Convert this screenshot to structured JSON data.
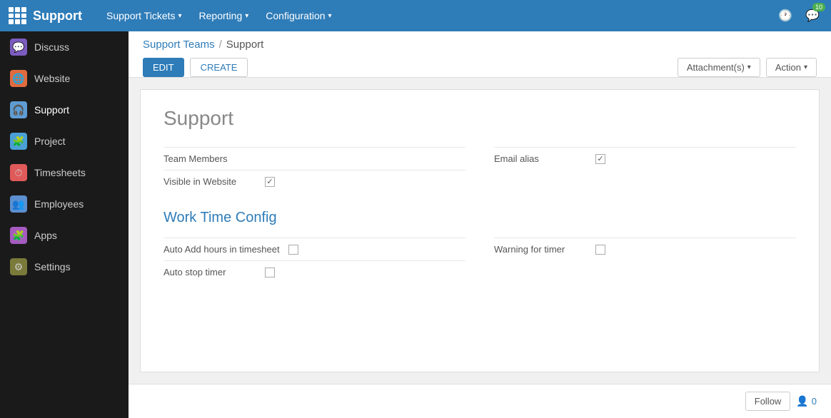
{
  "app": {
    "name": "Support",
    "grid_icon": "grid-icon"
  },
  "topnav": {
    "items": [
      {
        "label": "Support Tickets",
        "has_dropdown": true
      },
      {
        "label": "Reporting",
        "has_dropdown": true
      },
      {
        "label": "Configuration",
        "has_dropdown": true
      }
    ]
  },
  "topbar_right": {
    "clock_icon": "clock-icon",
    "messages_icon": "messages-icon",
    "messages_badge": "10"
  },
  "sidebar": {
    "items": [
      {
        "label": "Discuss",
        "icon_class": "icon-discuss",
        "icon": "💬"
      },
      {
        "label": "Website",
        "icon_class": "icon-website",
        "icon": "🌐"
      },
      {
        "label": "Support",
        "icon_class": "icon-support",
        "icon": "🎧",
        "active": true
      },
      {
        "label": "Project",
        "icon_class": "icon-project",
        "icon": "🧩"
      },
      {
        "label": "Timesheets",
        "icon_class": "icon-timesheets",
        "icon": "⏱"
      },
      {
        "label": "Employees",
        "icon_class": "icon-employees",
        "icon": "👥"
      },
      {
        "label": "Apps",
        "icon_class": "icon-apps",
        "icon": "🧩"
      },
      {
        "label": "Settings",
        "icon_class": "icon-settings",
        "icon": "⚙"
      }
    ]
  },
  "breadcrumb": {
    "parent_label": "Support Teams",
    "separator": "/",
    "current_label": "Support"
  },
  "toolbar": {
    "edit_label": "EDIT",
    "create_label": "CREATE",
    "attachments_label": "Attachment(s)",
    "action_label": "Action"
  },
  "form": {
    "title": "Support",
    "fields_left": [
      {
        "label": "Team Members",
        "type": "text",
        "value": ""
      },
      {
        "label": "Visible in Website",
        "type": "checkbox",
        "checked": true
      }
    ],
    "fields_right": [
      {
        "label": "Email alias",
        "type": "checkbox",
        "checked": true
      }
    ],
    "section": {
      "title": "Work Time Config",
      "fields_left": [
        {
          "label": "Auto Add hours in timesheet",
          "type": "checkbox",
          "checked": false
        },
        {
          "label": "Auto stop timer",
          "type": "checkbox",
          "checked": false
        }
      ],
      "fields_right": [
        {
          "label": "Warning for timer",
          "type": "checkbox",
          "checked": false
        }
      ]
    }
  },
  "bottom": {
    "follow_label": "Follow",
    "followers_count": "0",
    "followers_icon": "👤"
  }
}
